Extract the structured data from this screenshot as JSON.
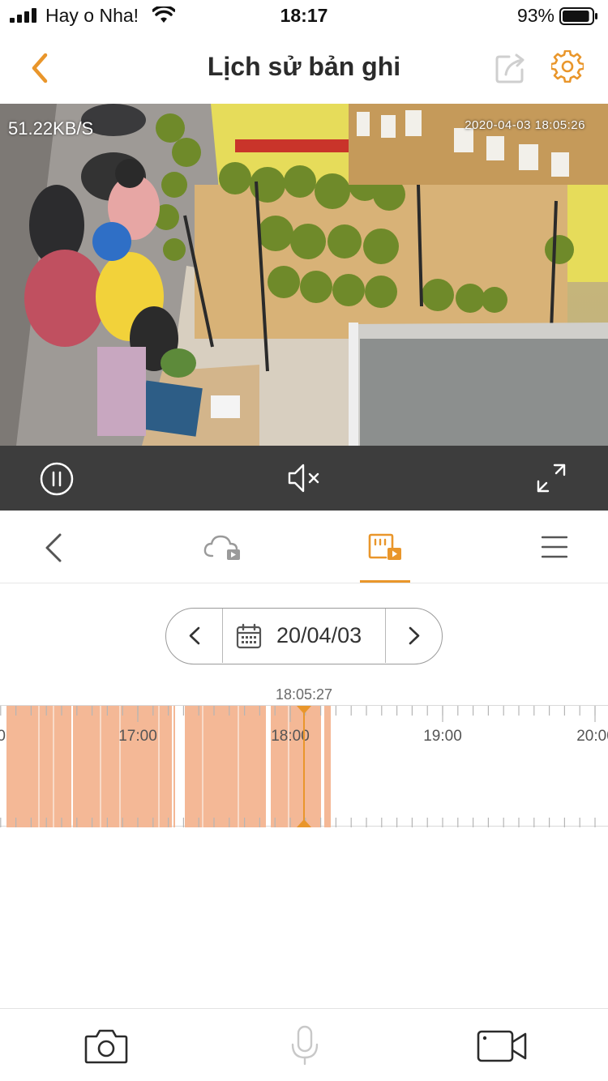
{
  "status_bar": {
    "carrier": "Hay o Nha!",
    "time": "18:17",
    "battery": "93%",
    "battery_level": 0.93
  },
  "header": {
    "title": "Lịch sử bản ghi"
  },
  "video": {
    "bitrate": "51.22KB/S",
    "timestamp": "2020-04-03 18:05:26"
  },
  "date_selector": {
    "date": "20/04/03"
  },
  "timeline": {
    "cursor_time": "18:05:27",
    "tick_labels": [
      "17:00",
      "18:00",
      "19:00",
      "20:00"
    ],
    "partial_left_label": "0"
  },
  "colors": {
    "accent": "#e9962b",
    "recording": "#f4b896",
    "control_bar": "#3d3d3d"
  },
  "icons": {
    "nav_back": "chevron-left-icon",
    "share": "share-icon",
    "settings": "gear-icon",
    "pause": "pause-icon",
    "mute": "speaker-muted-icon",
    "fullscreen": "fullscreen-icon",
    "cloud": "cloud-video-icon",
    "sd_card": "sd-card-video-icon",
    "menu": "hamburger-icon",
    "calendar": "calendar-icon",
    "snapshot": "camera-icon",
    "mic": "microphone-icon",
    "record": "video-camera-icon"
  }
}
